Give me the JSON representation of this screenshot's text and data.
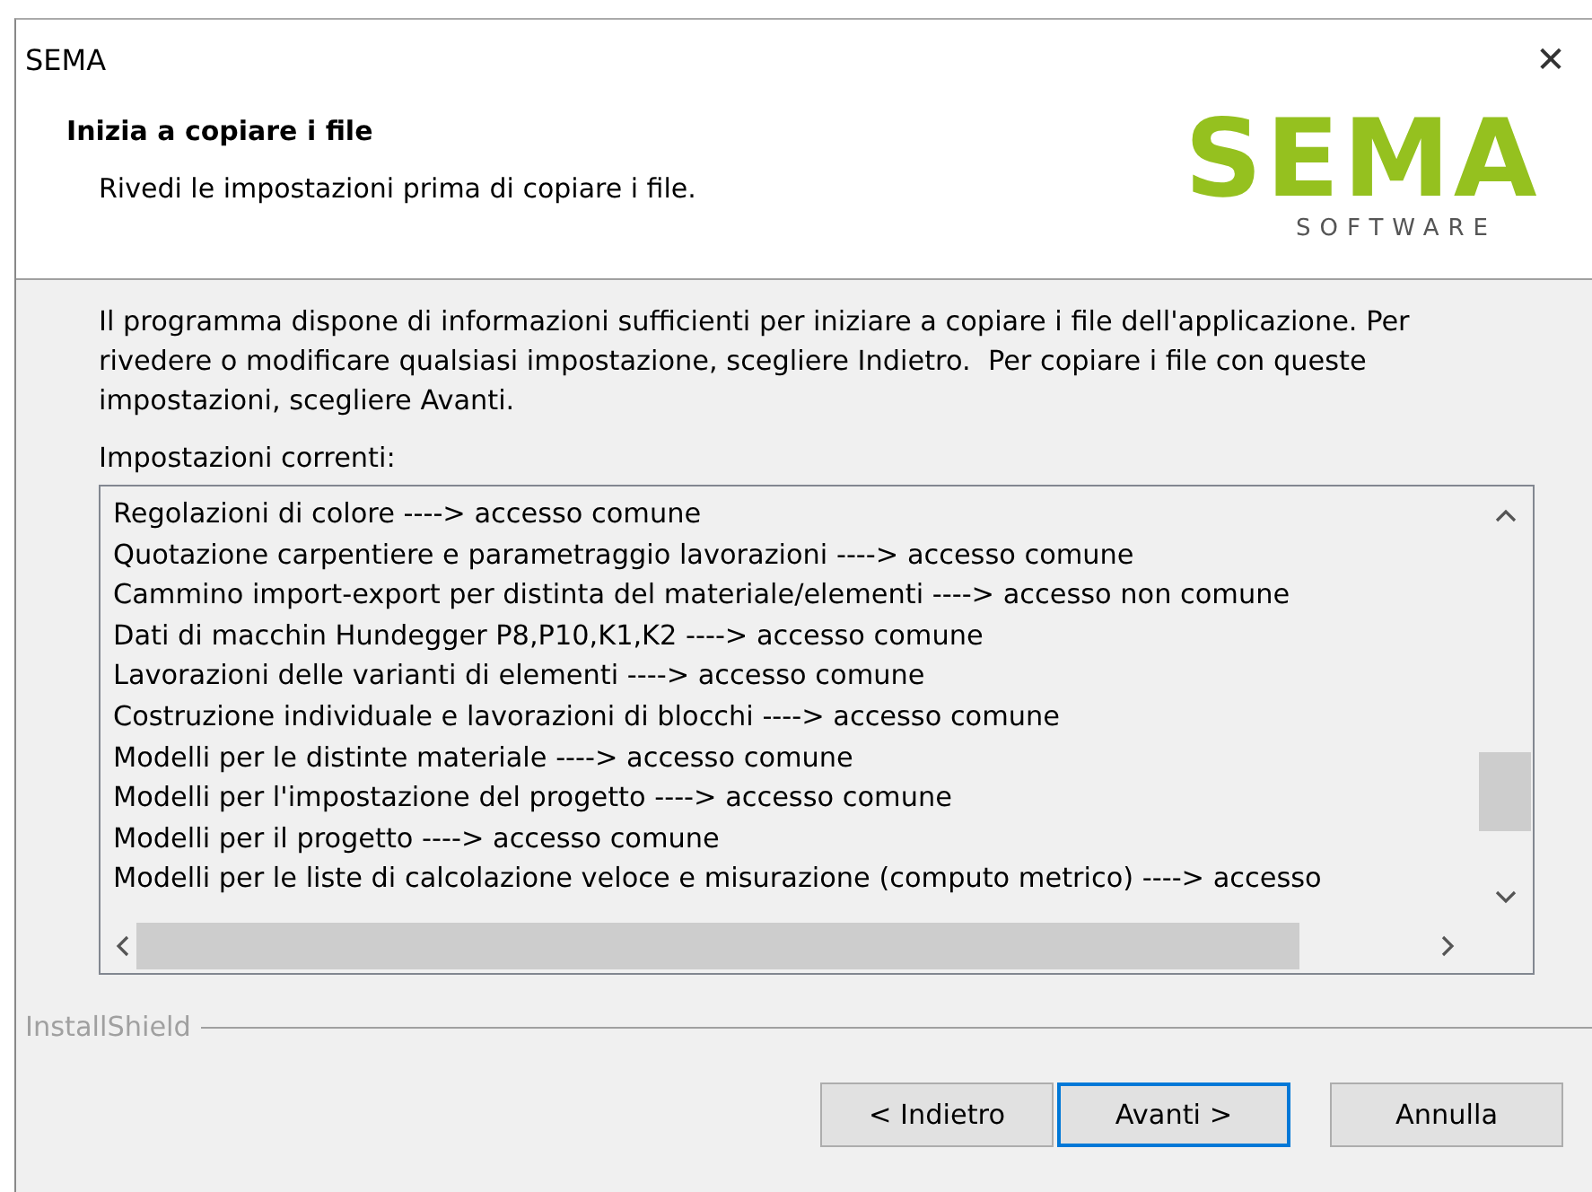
{
  "window": {
    "title": "SEMA",
    "close": "✕"
  },
  "header": {
    "title": "Inizia a copiare i file",
    "subtitle": "Rivedi le impostazioni prima di copiare i file.",
    "logo": {
      "name": "SEMA",
      "tagline": "SOFTWARE"
    }
  },
  "intro": "Il programma dispone di informazioni sufficienti per iniziare a copiare i file dell'applicazione. Per rivedere o modificare qualsiasi impostazione, scegliere Indietro.  Per copiare i file con queste impostazioni, scegliere Avanti.",
  "settings_label": "Impostazioni correnti:",
  "settings": [
    "Regolazioni di colore ----> accesso comune",
    "Quotazione carpentiere e parametraggio lavorazioni ----> accesso comune",
    "Cammino import-export per distinta del materiale/elementi ----> accesso non comune",
    "Dati di macchin Hundegger P8,P10,K1,K2 ----> accesso comune",
    "Lavorazioni delle varianti di elementi ----> accesso comune",
    "Costruzione individuale e lavorazioni di blocchi ----> accesso comune",
    "Modelli per le distinte materiale ----> accesso comune",
    "Modelli per l'impostazione del progetto ----> accesso comune",
    "Modelli per il progetto ----> accesso comune",
    "Modelli per le liste di calcolazione veloce e misurazione (computo metrico) ----> accesso"
  ],
  "group_label": "InstallShield",
  "buttons": [
    {
      "label": "< Indietro",
      "focused": false
    },
    {
      "label": "Avanti >",
      "focused": true
    },
    {
      "label": "Annulla",
      "focused": false
    }
  ]
}
